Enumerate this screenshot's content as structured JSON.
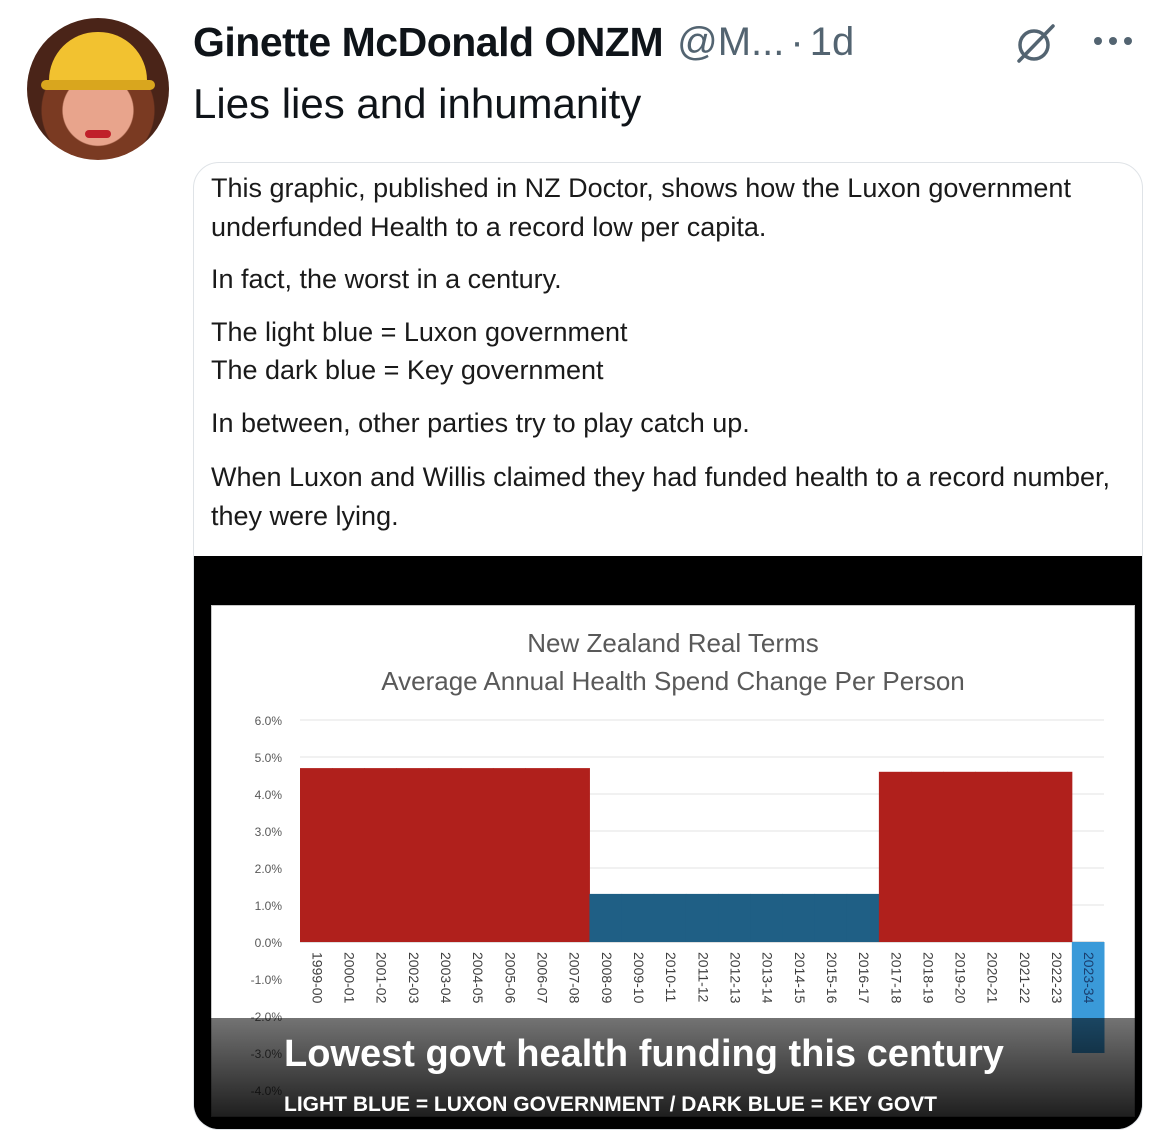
{
  "tweet": {
    "author_name": "Ginette McDonald ONZM",
    "handle": "@M...",
    "separator": "·",
    "time": "1d",
    "text": "Lies lies and inhumanity"
  },
  "card": {
    "paragraphs": [
      "This graphic, published in NZ Doctor, shows how the Luxon government underfunded Health to a record low per capita.",
      "In fact, the worst in a century.",
      "The light blue = Luxon government",
      "The dark blue = Key government",
      "In between, other parties try to play catch up.",
      "When Luxon and Willis claimed they had funded health to a record number, they were lying."
    ],
    "caption": "Lowest govt health funding this century",
    "subcaption": "LIGHT BLUE = LUXON GOVERNMENT / DARK BLUE = KEY GOVT"
  },
  "chart_data": {
    "type": "bar",
    "title": "New Zealand Real Terms",
    "subtitle": "Average Annual Health Spend Change Per Person",
    "categories": [
      "1999-00",
      "2000-01",
      "2001-02",
      "2002-03",
      "2003-04",
      "2004-05",
      "2005-06",
      "2006-07",
      "2007-08",
      "2008-09",
      "2009-10",
      "2010-11",
      "2011-12",
      "2012-13",
      "2013-14",
      "2014-15",
      "2015-16",
      "2016-17",
      "2017-18",
      "2018-19",
      "2019-20",
      "2020-21",
      "2021-22",
      "2022-23",
      "2023-34"
    ],
    "values": [
      4.7,
      4.7,
      4.7,
      4.7,
      4.7,
      4.7,
      4.7,
      4.7,
      4.7,
      1.3,
      1.3,
      1.3,
      1.3,
      1.3,
      1.3,
      1.3,
      1.3,
      1.3,
      4.6,
      4.6,
      4.6,
      4.6,
      4.6,
      4.6,
      -3.0
    ],
    "bar_colors": [
      "#b0201c",
      "#b0201c",
      "#b0201c",
      "#b0201c",
      "#b0201c",
      "#b0201c",
      "#b0201c",
      "#b0201c",
      "#b0201c",
      "#1f5f85",
      "#1f5f85",
      "#1f5f85",
      "#1f5f85",
      "#1f5f85",
      "#1f5f85",
      "#1f5f85",
      "#1f5f85",
      "#1f5f85",
      "#b0201c",
      "#b0201c",
      "#b0201c",
      "#b0201c",
      "#b0201c",
      "#b0201c",
      "#3a9ad9"
    ],
    "ytick_labels": [
      "6.0%",
      "5.0%",
      "4.0%",
      "3.0%",
      "2.0%",
      "1.0%",
      "0.0%",
      "-1.0%",
      "-2.0%",
      "-3.0%",
      "-4.0%"
    ],
    "ylim": [
      -4.0,
      6.0
    ],
    "grid": true,
    "xlabel": "",
    "ylabel": ""
  }
}
